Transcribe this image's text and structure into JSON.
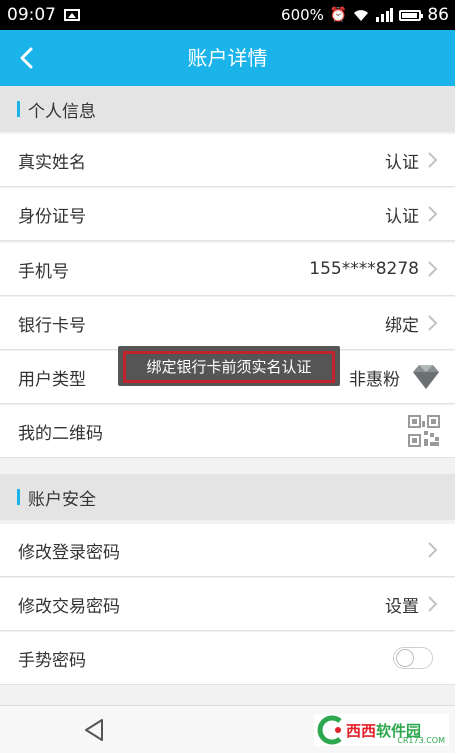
{
  "status_bar": {
    "time": "09:07",
    "battery_text": "600%",
    "battery_level": "86",
    "network": "4G"
  },
  "header": {
    "title": "账户详情"
  },
  "sections": {
    "personal": "个人信息",
    "security": "账户安全"
  },
  "personal_rows": {
    "real_name": {
      "label": "真实姓名",
      "value": "认证"
    },
    "id_number": {
      "label": "身份证号",
      "value": "认证"
    },
    "phone": {
      "label": "手机号",
      "value": "155****8278"
    },
    "bank_card": {
      "label": "银行卡号",
      "value": "绑定"
    },
    "user_type": {
      "label": "用户类型",
      "value": "非惠粉"
    },
    "qr_code": {
      "label": "我的二维码"
    }
  },
  "security_rows": {
    "login_password": {
      "label": "修改登录密码"
    },
    "trade_password": {
      "label": "修改交易密码",
      "value": "设置"
    },
    "gesture_password": {
      "label": "手势密码",
      "enabled": false
    }
  },
  "tooltip": {
    "text": "绑定银行卡前须实名认证"
  },
  "watermark": {
    "name_red": "西西",
    "name_green": "软件园",
    "domain": "CR173.COM"
  },
  "colors": {
    "accent": "#1ab4eb",
    "tooltip_border": "#c0232b"
  }
}
